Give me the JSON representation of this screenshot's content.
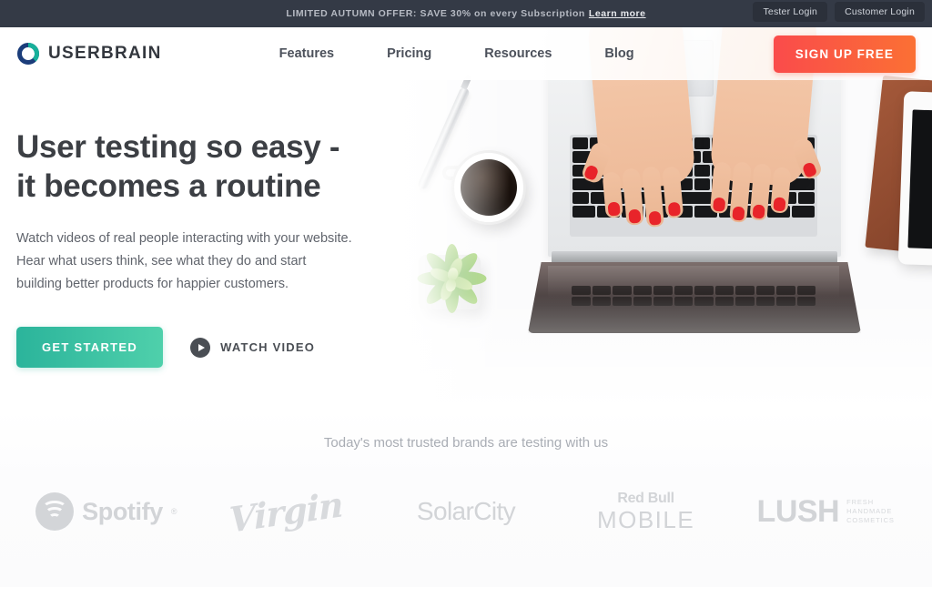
{
  "announcement": {
    "text": "LIMITED AUTUMN OFFER: SAVE 30% on every Subscription",
    "link_label": "Learn more",
    "tester_login": "Tester Login",
    "customer_login": "Customer Login",
    "bg_color": "#343a46"
  },
  "header": {
    "logo_text": "USERBRAIN",
    "logo_colors": {
      "teal": "#17b09a",
      "navy": "#1b3d7a"
    },
    "nav": [
      {
        "label": "Features"
      },
      {
        "label": "Pricing"
      },
      {
        "label": "Resources"
      },
      {
        "label": "Blog"
      }
    ],
    "signup_label": "SIGN UP FREE",
    "signup_color": "#fb5a42"
  },
  "hero": {
    "headline_line1": "User testing so easy -",
    "headline_line2": "it becomes a routine",
    "paragraph_line1": "Watch videos of real people interacting with your website.",
    "paragraph_line2": "Hear what users think, see what they do and start",
    "paragraph_line3": "building better products for happier customers.",
    "primary_cta": "GET STARTED",
    "primary_cta_color": "#2bb49b",
    "secondary_cta": "WATCH VIDEO",
    "image_alt": "Top-down photo of hands typing on a laptop with coffee cup, pen, succulent plant and tablet on a white desk"
  },
  "brands": {
    "title": "Today's most trusted brands are testing with us",
    "logos": [
      {
        "name": "Spotify",
        "reg": "®"
      },
      {
        "name": "Virgin"
      },
      {
        "name": "SolarCity"
      },
      {
        "name": "Red Bull",
        "second_line": "MOBILE"
      },
      {
        "name": "LUSH",
        "tagline_line1": "FRESH",
        "tagline_line2": "HANDMADE",
        "tagline_line3": "COSMETICS"
      }
    ]
  }
}
